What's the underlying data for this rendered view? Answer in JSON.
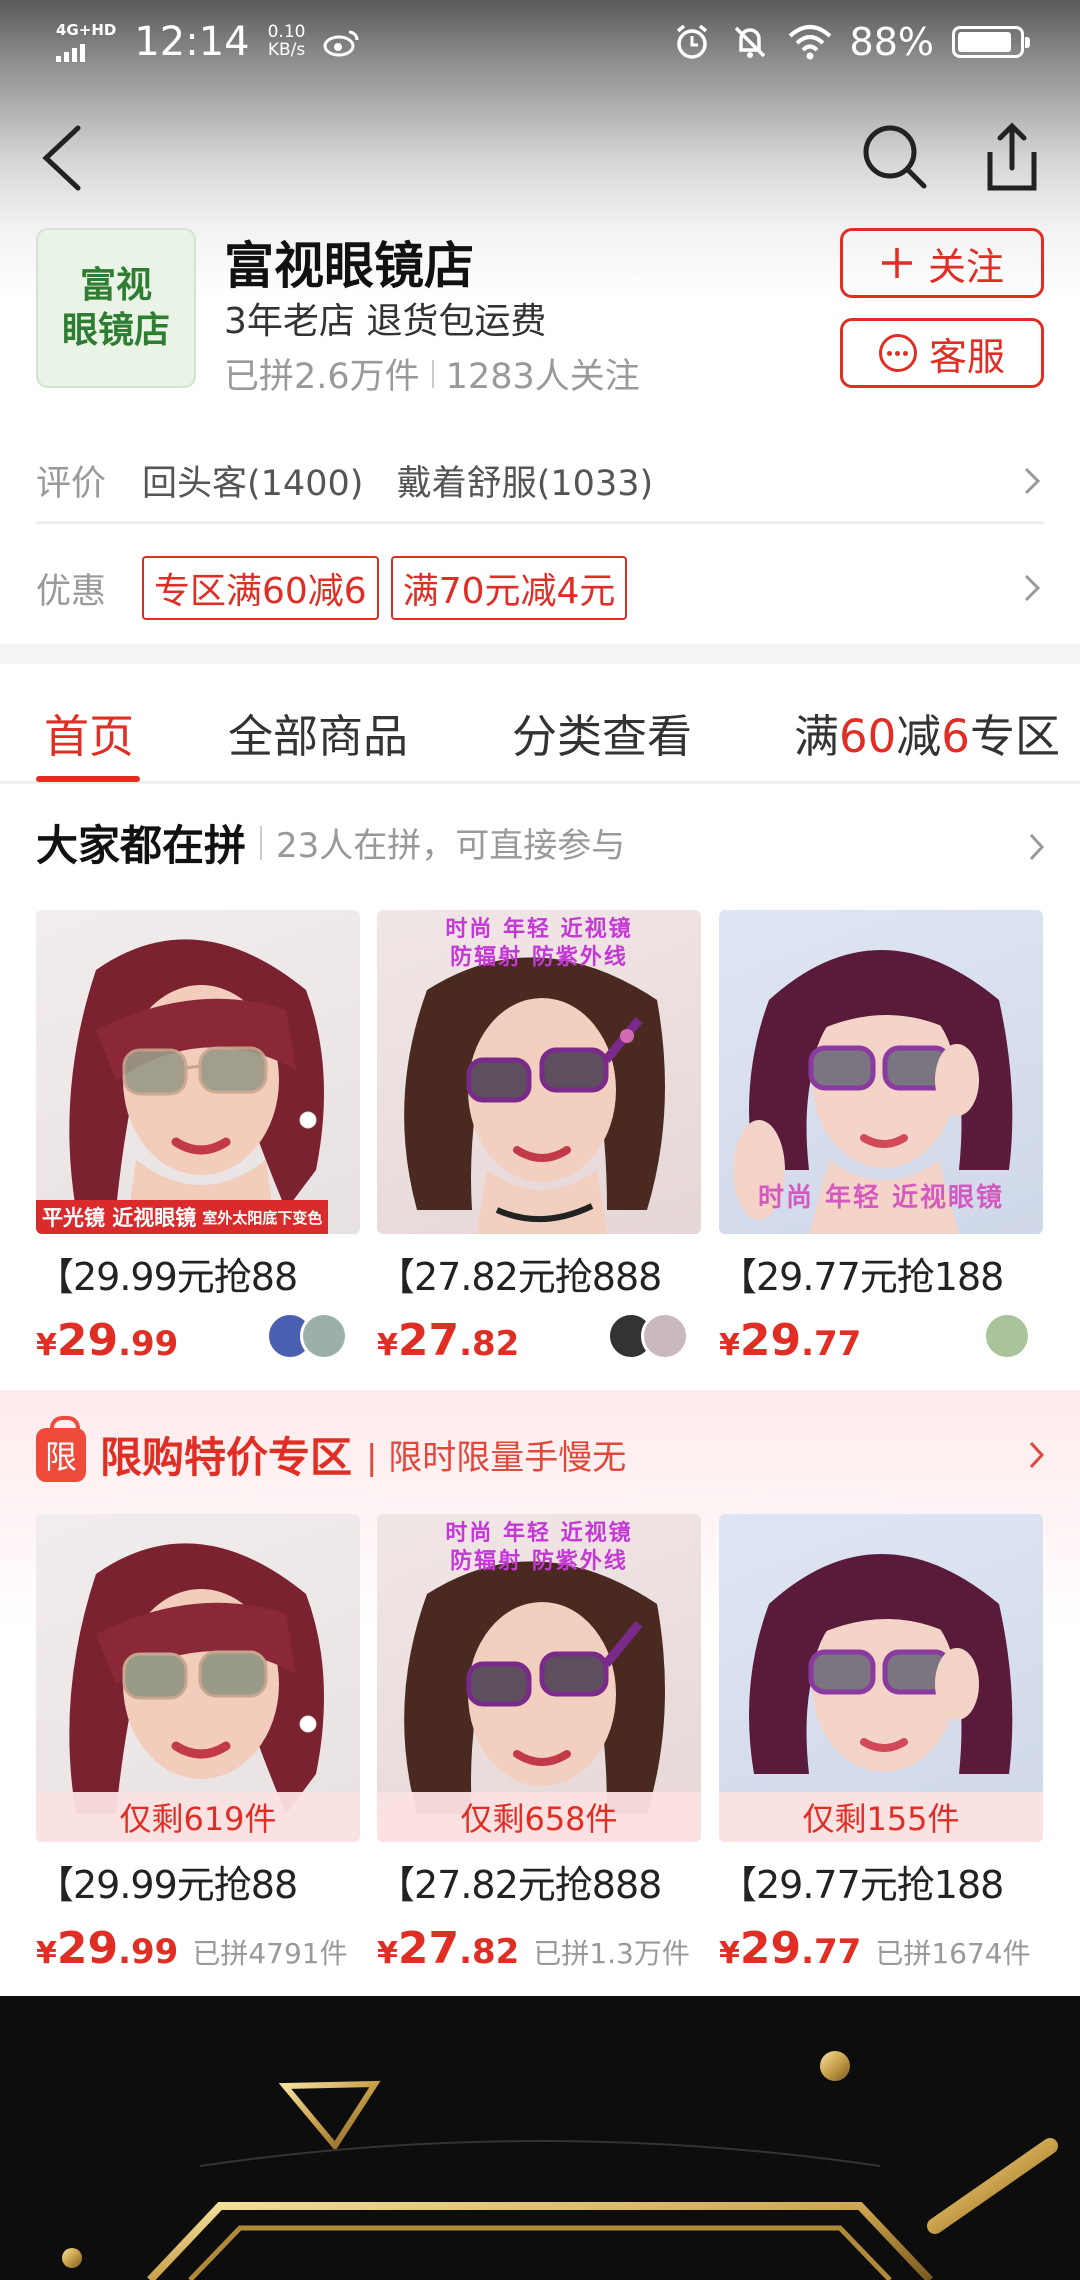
{
  "status_bar": {
    "network": "4G+HD",
    "time": "12:14",
    "speed_value": "0.10",
    "speed_unit": "KB/s",
    "battery": "88%"
  },
  "nav": {
    "back_icon": "chevron-left-icon",
    "search_icon": "search-icon",
    "share_icon": "share-icon"
  },
  "store": {
    "logo_line1": "富视",
    "logo_line2": "眼镜店",
    "name": "富视眼镜店",
    "tags": "3年老店 退货包运费",
    "sold": "已拼2.6万件",
    "followers": "1283人关注",
    "follow_label": "关注",
    "service_label": "客服"
  },
  "review": {
    "label": "评价",
    "items": "回头客(1400)   戴着舒服(1033)"
  },
  "promo": {
    "label": "优惠",
    "coupons": [
      "专区满60减6",
      "满70元减4元"
    ]
  },
  "tabs": {
    "home": "首页",
    "all": "全部商品",
    "category": "分类查看",
    "zone_prefix": "满",
    "zone_n1": "60",
    "zone_mid": "减",
    "zone_n2": "6",
    "zone_suffix": "专区"
  },
  "group": {
    "title": "大家都在拼",
    "subtitle": "23人在拼，可直接参与",
    "products": [
      {
        "title": "【29.99元抢88",
        "price_int": "29",
        "price_dec": ".99",
        "overlay": "平光镜 近视眼镜",
        "overlay_small": "室外太阳底下变色"
      },
      {
        "title": "【27.82元抢888",
        "price_int": "27",
        "price_dec": ".82",
        "overlay_line1": "时尚 年轻 近视镜",
        "overlay_line2": "防辐射 防紫外线"
      },
      {
        "title": "【29.77元抢188",
        "price_int": "29",
        "price_dec": ".77",
        "overlay": "时尚  年轻  近视眼镜"
      }
    ]
  },
  "limited": {
    "badge": "限",
    "title": "限购特价专区",
    "subtitle": "| 限时限量手慢无",
    "products": [
      {
        "remain": "仅剩619件",
        "title": "【29.99元抢88",
        "price_int": "29",
        "price_dec": ".99",
        "sold": "已拼4791件"
      },
      {
        "remain": "仅剩658件",
        "title": "【27.82元抢888",
        "price_int": "27",
        "price_dec": ".82",
        "sold": "已拼1.3万件",
        "overlay_line1": "时尚 年轻 近视镜",
        "overlay_line2": "防辐射 防紫外线"
      },
      {
        "remain": "仅剩155件",
        "title": "【29.77元抢188",
        "price_int": "29",
        "price_dec": ".77",
        "sold": "已拼1674件"
      }
    ]
  },
  "currency": "¥",
  "colors": {
    "accent": "#e02e24",
    "store_green": "#2e7d32"
  }
}
